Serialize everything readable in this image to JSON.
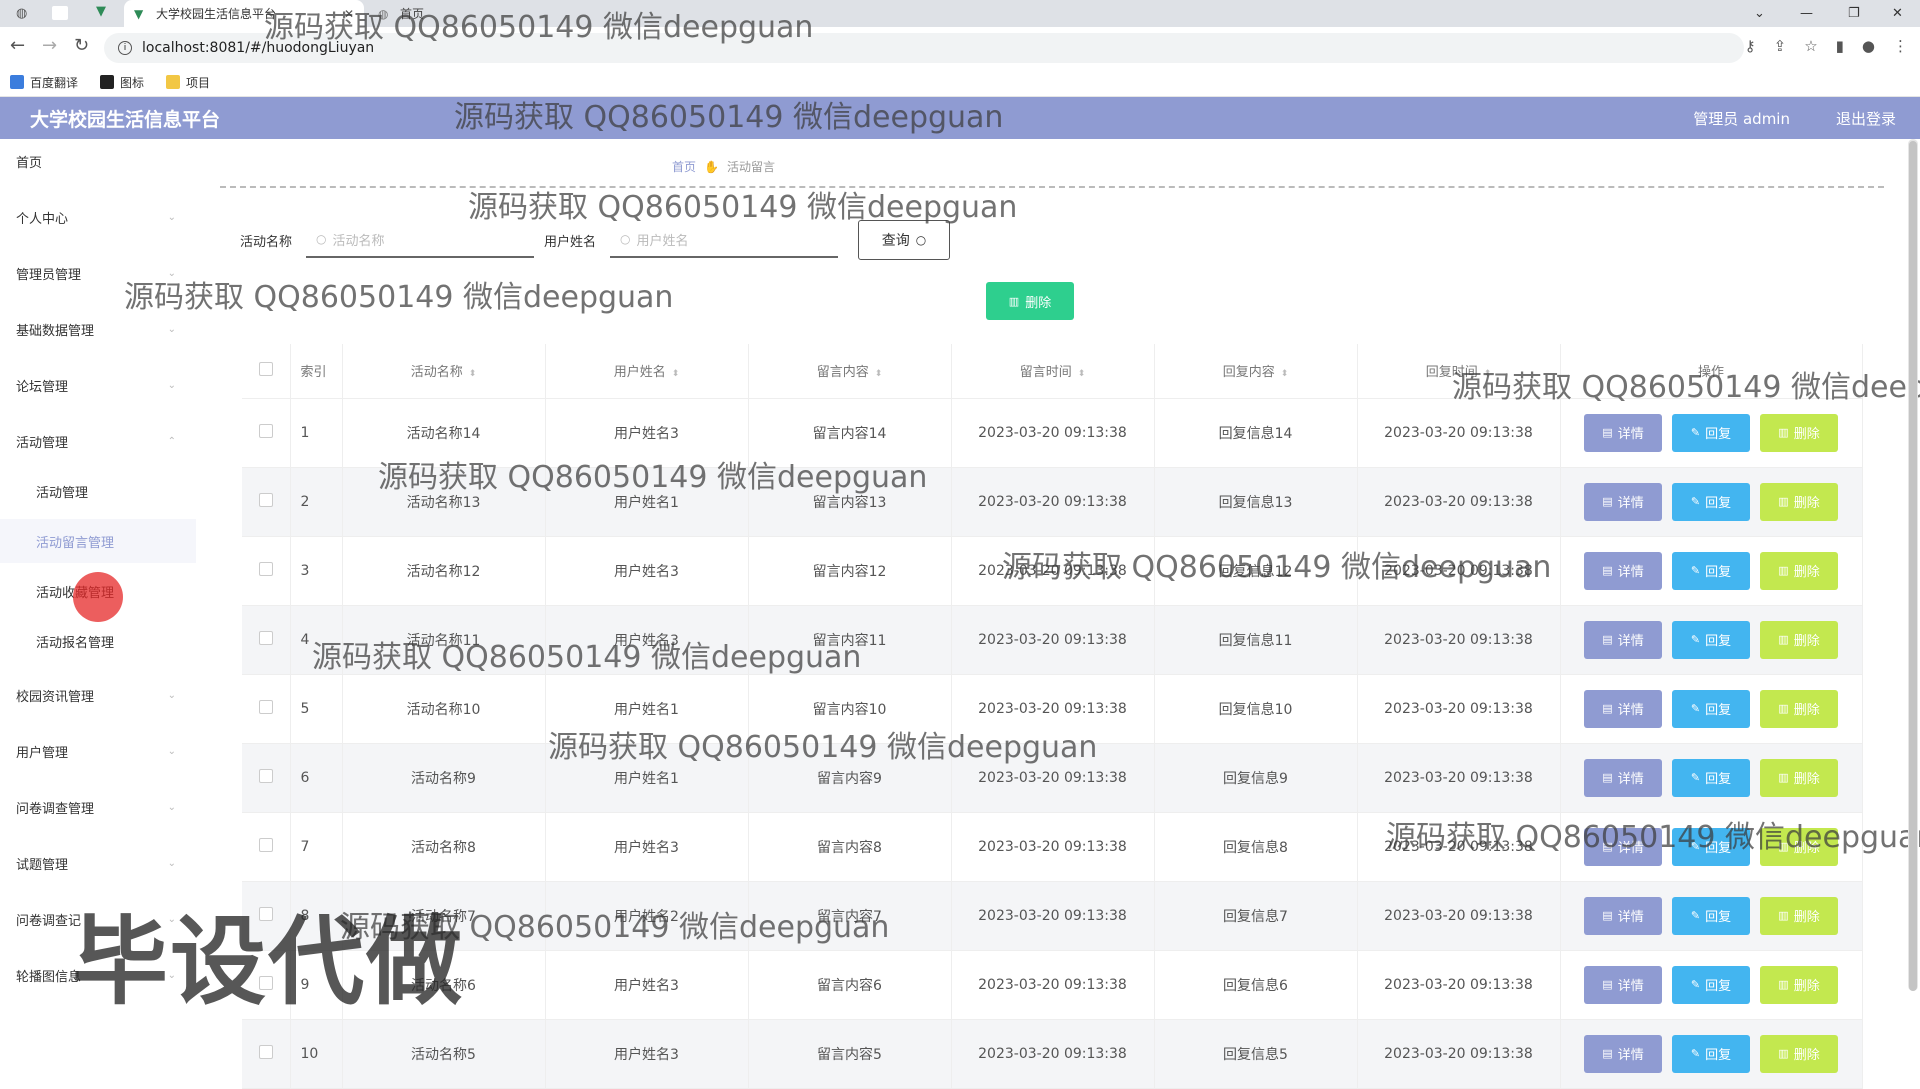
{
  "browser": {
    "tab_active_title": "大学校园生活信息平台",
    "tab_other_title": "首页",
    "url": "localhost:8081/#/huodongLiuyan",
    "bookmarks": [
      "百度翻译",
      "图标",
      "项目"
    ]
  },
  "header": {
    "title": "大学校园生活信息平台",
    "user": "管理员 admin",
    "logout": "退出登录"
  },
  "sidebar": {
    "items": [
      {
        "label": "首页"
      },
      {
        "label": "个人中心"
      },
      {
        "label": "管理员管理"
      },
      {
        "label": "基础数据管理"
      },
      {
        "label": "论坛管理"
      },
      {
        "label": "活动管理"
      },
      {
        "label": "活动管理"
      },
      {
        "label": "活动留言管理"
      },
      {
        "label": "活动收藏管理"
      },
      {
        "label": "活动报名管理"
      },
      {
        "label": "校园资讯管理"
      },
      {
        "label": "用户管理"
      },
      {
        "label": "问卷调查管理"
      },
      {
        "label": "试题管理"
      },
      {
        "label": "问卷调查记"
      },
      {
        "label": "轮播图信息"
      }
    ]
  },
  "breadcrumb": {
    "home": "首页",
    "current": "活动留言"
  },
  "search": {
    "activity_label": "活动名称",
    "activity_placeholder": "活动名称",
    "user_label": "用户姓名",
    "user_placeholder": "用户姓名",
    "query_label": "查询"
  },
  "batch_delete_label": "删除",
  "table": {
    "headers": [
      "索引",
      "活动名称",
      "用户姓名",
      "留言内容",
      "留言时间",
      "回复内容",
      "回复时间",
      "操作"
    ],
    "rows": [
      {
        "idx": "1",
        "activity": "活动名称14",
        "user": "用户姓名3",
        "content": "留言内容14",
        "time": "2023-03-20 09:13:38",
        "reply": "回复信息14",
        "reply_time": "2023-03-20 09:13:38"
      },
      {
        "idx": "2",
        "activity": "活动名称13",
        "user": "用户姓名1",
        "content": "留言内容13",
        "time": "2023-03-20 09:13:38",
        "reply": "回复信息13",
        "reply_time": "2023-03-20 09:13:38"
      },
      {
        "idx": "3",
        "activity": "活动名称12",
        "user": "用户姓名3",
        "content": "留言内容12",
        "time": "2023-03-20 09:13:38",
        "reply": "回复信息12",
        "reply_time": "2023-03-20 09:13:38"
      },
      {
        "idx": "4",
        "activity": "活动名称11",
        "user": "用户姓名3",
        "content": "留言内容11",
        "time": "2023-03-20 09:13:38",
        "reply": "回复信息11",
        "reply_time": "2023-03-20 09:13:38"
      },
      {
        "idx": "5",
        "activity": "活动名称10",
        "user": "用户姓名1",
        "content": "留言内容10",
        "time": "2023-03-20 09:13:38",
        "reply": "回复信息10",
        "reply_time": "2023-03-20 09:13:38"
      },
      {
        "idx": "6",
        "activity": "活动名称9",
        "user": "用户姓名1",
        "content": "留言内容9",
        "time": "2023-03-20 09:13:38",
        "reply": "回复信息9",
        "reply_time": "2023-03-20 09:13:38"
      },
      {
        "idx": "7",
        "activity": "活动名称8",
        "user": "用户姓名3",
        "content": "留言内容8",
        "time": "2023-03-20 09:13:38",
        "reply": "回复信息8",
        "reply_time": "2023-03-20 09:13:38"
      },
      {
        "idx": "8",
        "activity": "活动名称7",
        "user": "用户姓名2",
        "content": "留言内容7",
        "time": "2023-03-20 09:13:38",
        "reply": "回复信息7",
        "reply_time": "2023-03-20 09:13:38"
      },
      {
        "idx": "9",
        "activity": "活动名称6",
        "user": "用户姓名3",
        "content": "留言内容6",
        "time": "2023-03-20 09:13:38",
        "reply": "回复信息6",
        "reply_time": "2023-03-20 09:13:38"
      },
      {
        "idx": "10",
        "activity": "活动名称5",
        "user": "用户姓名3",
        "content": "留言内容5",
        "time": "2023-03-20 09:13:38",
        "reply": "回复信息5",
        "reply_time": "2023-03-20 09:13:38"
      }
    ],
    "actions": {
      "detail": "详情",
      "reply": "回复",
      "delete": "删除"
    }
  },
  "watermark": {
    "text": "源码获取 QQ86050149 微信deepguan",
    "big": "毕设代做"
  },
  "colors": {
    "header": "#8f9bd2",
    "batch_delete": "#2ecf8e",
    "detail": "#8f9bd2",
    "reply": "#43b5f0",
    "delete": "#c3e84f"
  }
}
